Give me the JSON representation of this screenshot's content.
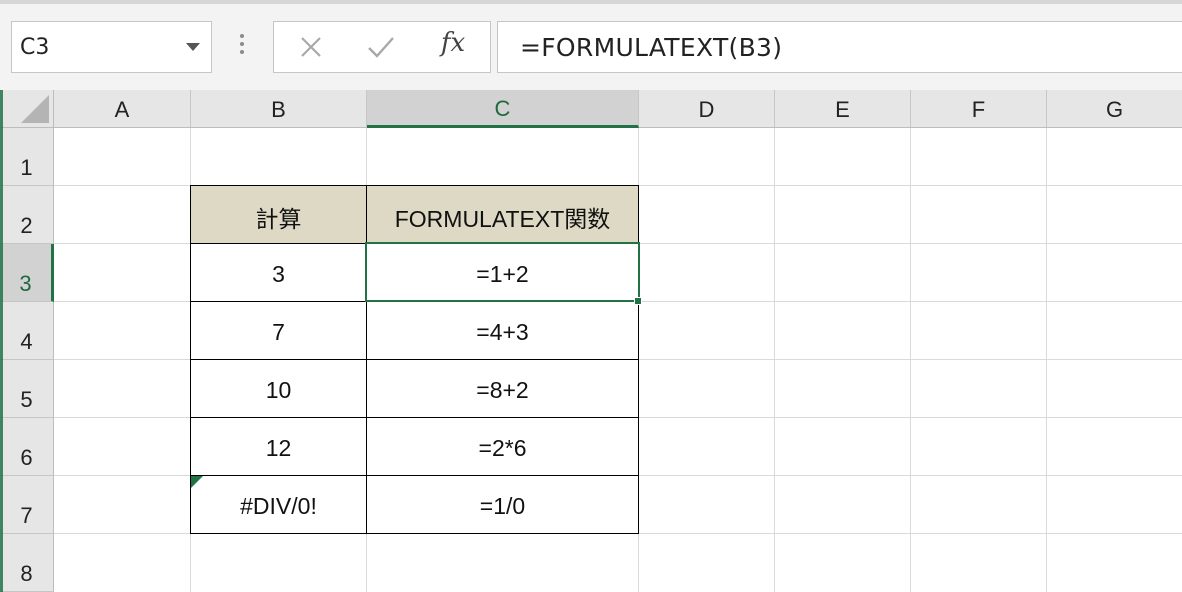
{
  "name_box": {
    "value": "C3"
  },
  "formula_bar": {
    "cancel_icon": "close-icon",
    "enter_icon": "check-icon",
    "fx_label": "fx",
    "formula": "=FORMULATEXT(B3)"
  },
  "columns": [
    "A",
    "B",
    "C",
    "D",
    "E",
    "F",
    "G"
  ],
  "active_column": "C",
  "rows": [
    "1",
    "2",
    "3",
    "4",
    "5",
    "6",
    "7",
    "8"
  ],
  "active_row": "3",
  "table": {
    "headers": [
      "計算",
      "FORMULATEXT関数"
    ],
    "rows": [
      [
        "3",
        "=1+2"
      ],
      [
        "7",
        "=4+3"
      ],
      [
        "10",
        "=8+2"
      ],
      [
        "12",
        "=2*6"
      ],
      [
        "#DIV/0!",
        "=1/0"
      ]
    ]
  },
  "colors": {
    "accent": "#217346",
    "header_fill": "#ddd9c4"
  }
}
